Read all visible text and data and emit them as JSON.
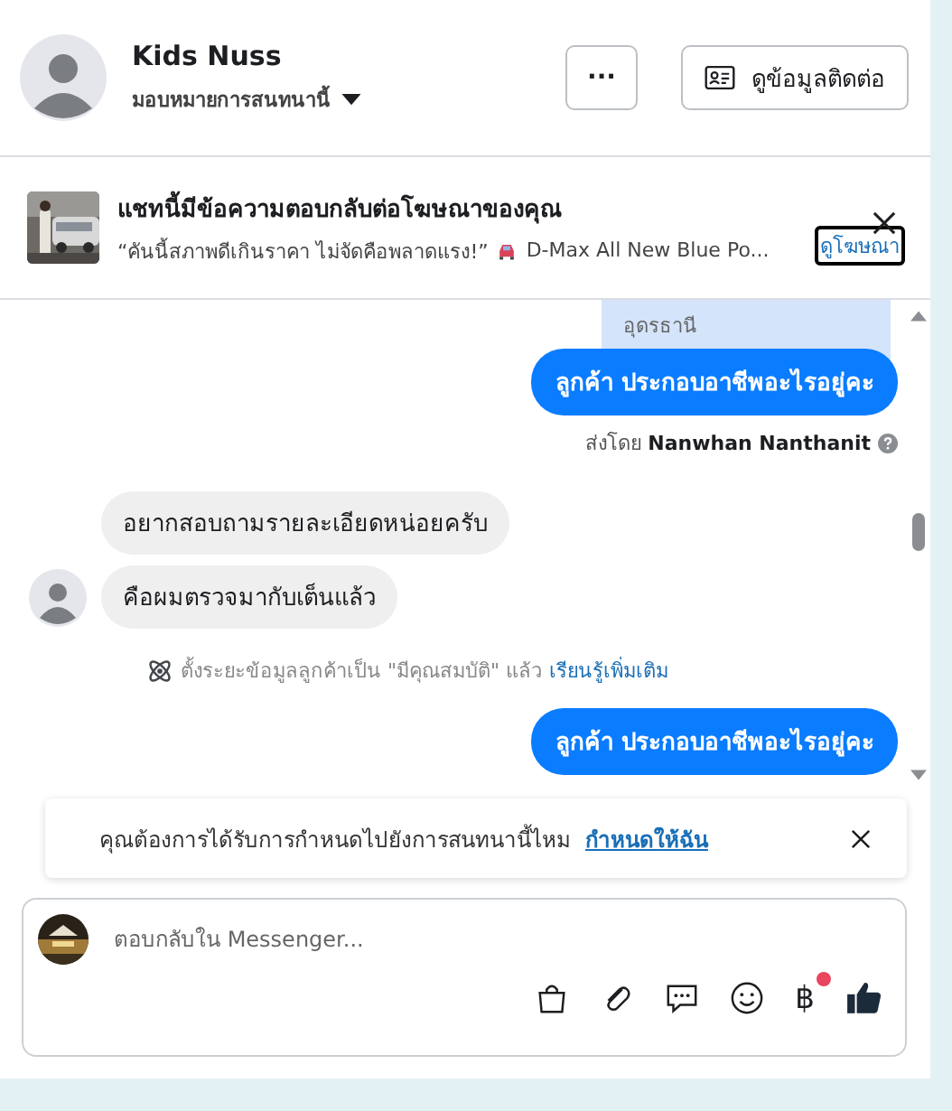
{
  "contact": {
    "name": "Kids Nuss",
    "assign_label": "มอบหมายการสนทนานี้"
  },
  "header_buttons": {
    "more": "···",
    "contact_info": "ดูข้อมูลติดต่อ"
  },
  "ad_banner": {
    "title": "แชทนี้มีข้อความตอบกลับต่อโฆษณาของคุณ",
    "quote": "“คันนี้สภาพดีเกินราคา ไม่จัดคือพลาดแรง!”",
    "ad_name": "D-Max All New Blue Po...",
    "link": "ดูโฆษณา"
  },
  "messages": [
    {
      "kind": "note",
      "text": "อุดรธานี"
    },
    {
      "kind": "outgoing",
      "text": "ลูกค้า ประกอบอาชีพอะไรอยู่คะ"
    },
    {
      "kind": "sent_by",
      "prefix": "ส่งโดย",
      "name": "Nanwhan Nanthanit"
    },
    {
      "kind": "incoming",
      "text": "อยากสอบถามรายละเอียดหน่อยครับ",
      "avatar": false
    },
    {
      "kind": "incoming",
      "text": "คือผมตรวจมากับเต็นแล้ว",
      "avatar": true
    },
    {
      "kind": "system",
      "text": "ตั้งระยะข้อมูลลูกค้าเป็น \"มีคุณสมบัติ\" แล้ว",
      "link": "เรียนรู้เพิ่มเติม"
    },
    {
      "kind": "outgoing",
      "text": "ลูกค้า ประกอบอาชีพอะไรอยู่คะ"
    }
  ],
  "assign_notice": {
    "text": "คุณต้องการได้รับการกำหนดไปยังการสนทนานี้ไหม",
    "link": "กำหนดให้ฉัน"
  },
  "composer": {
    "placeholder": "ตอบกลับใน Messenger...",
    "currency_symbol": "฿",
    "currency_badge": true
  }
}
